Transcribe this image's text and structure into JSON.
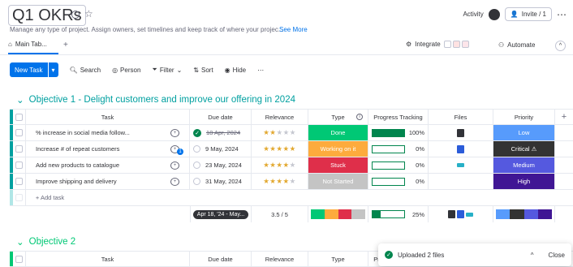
{
  "header": {
    "title": "Q1 OKRs",
    "description": "Manage any type of project. Assign owners, set timelines and keep track of where your projec...",
    "see_more": "See More",
    "activity": "Activity",
    "invite": "Invite / 1"
  },
  "tabs": {
    "main_tab": "Main Tab...",
    "integrate": "Integrate",
    "automate": "Automate"
  },
  "toolbar": {
    "new_task": "New Task",
    "search": "Search",
    "person": "Person",
    "filter": "Filter",
    "sort": "Sort",
    "hide": "Hide"
  },
  "columns": {
    "task": "Task",
    "due": "Due date",
    "relevance": "Relevance",
    "type": "Type",
    "progress": "Progress Tracking",
    "files": "Files",
    "priority": "Priority"
  },
  "group1": {
    "title": "Objective 1 - Delight customers and improve our offering in 2024",
    "color": "#00a0a0",
    "rows": [
      {
        "task": "% increase in social media follow...",
        "due": "18 Apr, 2024",
        "stars": 2,
        "type": "Done",
        "type_color": "#00c875",
        "progress": 1.0,
        "progress_text": "100%",
        "priority": "Low",
        "priority_color": "#579bfc",
        "file_color": "#323338"
      },
      {
        "task": "Increase # of repeat customers",
        "due": "9 May, 2024",
        "stars": 5,
        "type": "Working on it",
        "type_color": "#fdab3d",
        "progress": 0.0,
        "progress_text": "0%",
        "priority": "Critical ⚠",
        "priority_color": "#333333",
        "file_color": "#2b5cd9"
      },
      {
        "task": "Add new products to catalogue",
        "due": "23 May, 2024",
        "stars": 4,
        "type": "Stuck",
        "type_color": "#df2f4a",
        "progress": 0.0,
        "progress_text": "0%",
        "priority": "Medium",
        "priority_color": "#5559df",
        "file_color": "#27b0c7"
      },
      {
        "task": "Improve shipping and delivery",
        "due": "31 May, 2024",
        "stars": 4,
        "type": "Not Started",
        "type_color": "#c4c4c4",
        "progress": 0.0,
        "progress_text": "0%",
        "priority": "High",
        "priority_color": "#401694",
        "file_color": ""
      }
    ],
    "add_task": "+ Add task",
    "summary": {
      "due_range": "Apr 18, '24 - May...",
      "relevance": "3.5 / 5",
      "progress": 0.25,
      "progress_text": "25%"
    }
  },
  "group2": {
    "title": "Objective 2",
    "color": "#00c875"
  },
  "toast": {
    "message": "Uploaded 2 files",
    "close": "Close"
  }
}
